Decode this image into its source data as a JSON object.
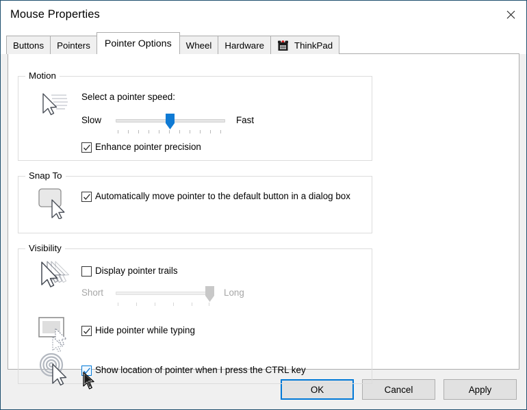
{
  "window": {
    "title": "Mouse Properties",
    "close_icon": "close-icon"
  },
  "tabs": [
    {
      "label": "Buttons",
      "active": false
    },
    {
      "label": "Pointers",
      "active": false
    },
    {
      "label": "Pointer Options",
      "active": true
    },
    {
      "label": "Wheel",
      "active": false
    },
    {
      "label": "Hardware",
      "active": false
    },
    {
      "label": "ThinkPad",
      "active": false,
      "icon": "thinkpad-trackpoint-icon"
    }
  ],
  "motion": {
    "group_title": "Motion",
    "icon": "pointer-motion-icon",
    "speed_label": "Select a pointer speed:",
    "slow_label": "Slow",
    "fast_label": "Fast",
    "slider": {
      "name": "pointer-speed-slider",
      "value_percent": 50,
      "tick_count": 11,
      "enabled": true
    },
    "enhance_precision": {
      "label": "Enhance pointer precision",
      "checked": true
    }
  },
  "snap_to": {
    "group_title": "Snap To",
    "icon": "snap-to-button-icon",
    "auto_move": {
      "label": "Automatically move pointer to the default button in a dialog box",
      "checked": true
    }
  },
  "visibility": {
    "group_title": "Visibility",
    "trails_icon": "pointer-trails-icon",
    "display_trails": {
      "label": "Display pointer trails",
      "checked": false
    },
    "trails_slider": {
      "name": "pointer-trails-slider",
      "short_label": "Short",
      "long_label": "Long",
      "value_percent": 92,
      "tick_count": 6,
      "enabled": false
    },
    "hide_icon": "hide-pointer-typing-icon",
    "hide_while_typing": {
      "label": "Hide pointer while typing",
      "checked": true
    },
    "locate_icon": "show-pointer-location-icon",
    "show_location": {
      "label": "Show location of pointer when I press the CTRL key",
      "checked": true,
      "hovered": true
    }
  },
  "footer": {
    "ok_label": "OK",
    "cancel_label": "Cancel",
    "apply_label": "Apply"
  },
  "colors": {
    "accent": "#0078d7",
    "dialog_bg": "#f0f0f0",
    "panel_bg": "#ffffff",
    "border": "#acacac",
    "disabled_text": "#a6a6a6"
  }
}
